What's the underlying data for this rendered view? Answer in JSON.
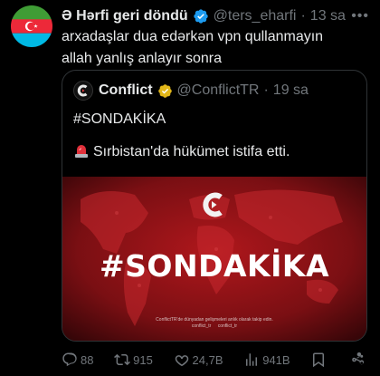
{
  "tweet": {
    "author_name": "Ə Hərfi geri döndü",
    "handle": "@ters_eharfi",
    "separator": "·",
    "time": "13 sa",
    "text_lines": [
      "arxadaşlar dua edərkən vpn qullanmayın",
      "allah yanlış anlayır sonra"
    ]
  },
  "quote": {
    "author_name": "Conflict",
    "handle": "@ConflictTR",
    "separator": "·",
    "time": "19 sa",
    "text_line1": "#SONDAKİKA",
    "text_line2": "Sırbistan'da hükümet istifa etti.",
    "media": {
      "title": "#SONDAKİKA",
      "footer_text": "ConflictTR'de dünyadan gelişmeleri anlık olarak takip edin.",
      "footer_social_1": "conflict_tr",
      "footer_social_2": "conflict_tr"
    }
  },
  "actions": {
    "replies": "88",
    "reposts": "915",
    "likes": "24,7B",
    "views": "941B"
  },
  "colors": {
    "background": "#000000",
    "text": "#e7e9ea",
    "muted": "#71767b",
    "verified_blue": "#1d9bf0",
    "verified_gold": "#e2b719",
    "media_red": "#6e0d10"
  },
  "icons": [
    "azerbaijan-flag-avatar",
    "verified-badge-icon",
    "more-icon",
    "conflict-logo-icon",
    "gold-verified-badge-icon",
    "siren-emoji-icon",
    "reply-icon",
    "repost-icon",
    "like-icon",
    "views-icon",
    "bookmark-icon",
    "share-icon"
  ]
}
